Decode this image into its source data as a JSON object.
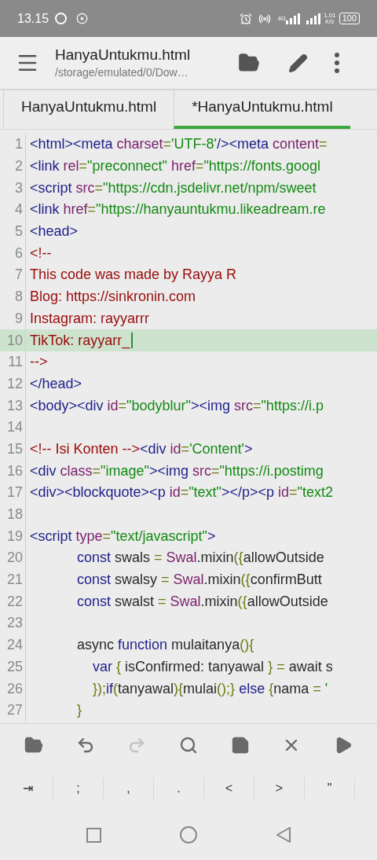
{
  "status_bar": {
    "time": "13.15",
    "network": "4G",
    "speed_value": "1,01",
    "speed_unit": "K/S",
    "battery": "100"
  },
  "header": {
    "title": "HanyaUntukmu.html",
    "path": "/storage/emulated/0/Dow…"
  },
  "tabs": [
    {
      "label": "HanyaUntukmu.html",
      "selected": false
    },
    {
      "label": "*HanyaUntukmu.html",
      "selected": true
    }
  ],
  "editor": {
    "lines": [
      {
        "number": "1",
        "current": false,
        "tokens": [
          {
            "kind": "tag",
            "text": "<html><meta "
          },
          {
            "kind": "attr",
            "text": "charset"
          },
          {
            "kind": "punct",
            "text": "="
          },
          {
            "kind": "str",
            "text": "'UTF-8'"
          },
          {
            "kind": "tag",
            "text": "/><meta "
          },
          {
            "kind": "attr",
            "text": "content"
          },
          {
            "kind": "punct",
            "text": "="
          }
        ]
      },
      {
        "number": "2",
        "current": false,
        "tokens": [
          {
            "kind": "tag",
            "text": "<link "
          },
          {
            "kind": "attr",
            "text": "rel"
          },
          {
            "kind": "punct",
            "text": "="
          },
          {
            "kind": "str",
            "text": "\"preconnect\""
          },
          {
            "kind": "attr",
            "text": " href"
          },
          {
            "kind": "punct",
            "text": "="
          },
          {
            "kind": "str",
            "text": "\"https://fonts.googl"
          }
        ]
      },
      {
        "number": "3",
        "current": false,
        "tokens": [
          {
            "kind": "tag",
            "text": "<script "
          },
          {
            "kind": "attr",
            "text": "src"
          },
          {
            "kind": "punct",
            "text": "="
          },
          {
            "kind": "str",
            "text": "\"https://cdn.jsdelivr.net/npm/sweet"
          }
        ]
      },
      {
        "number": "4",
        "current": false,
        "tokens": [
          {
            "kind": "tag",
            "text": "<link "
          },
          {
            "kind": "attr",
            "text": "href"
          },
          {
            "kind": "punct",
            "text": "="
          },
          {
            "kind": "str",
            "text": "\"https://hanyauntukmu.likeadream.re"
          }
        ]
      },
      {
        "number": "5",
        "current": false,
        "tokens": [
          {
            "kind": "tag",
            "text": "<head>"
          }
        ]
      },
      {
        "number": "6",
        "current": false,
        "tokens": [
          {
            "kind": "comment",
            "text": "<!--"
          }
        ]
      },
      {
        "number": "7",
        "current": false,
        "tokens": [
          {
            "kind": "comment",
            "text": "This code was made by Rayya R"
          }
        ]
      },
      {
        "number": "8",
        "current": false,
        "tokens": [
          {
            "kind": "comment",
            "text": "Blog: https://sinkronin.com"
          }
        ]
      },
      {
        "number": "9",
        "current": false,
        "tokens": [
          {
            "kind": "comment",
            "text": "Instagram: rayyarrr"
          }
        ]
      },
      {
        "number": "10",
        "current": true,
        "tokens": [
          {
            "kind": "comment",
            "text": "TikTok: rayyarr_"
          }
        ]
      },
      {
        "number": "11",
        "current": false,
        "tokens": [
          {
            "kind": "comment",
            "text": "-->"
          }
        ]
      },
      {
        "number": "12",
        "current": false,
        "tokens": [
          {
            "kind": "tag",
            "text": "</head>"
          }
        ]
      },
      {
        "number": "13",
        "current": false,
        "tokens": [
          {
            "kind": "tag",
            "text": "<body><div "
          },
          {
            "kind": "attr",
            "text": "id"
          },
          {
            "kind": "punct",
            "text": "="
          },
          {
            "kind": "str",
            "text": "\"bodyblur\""
          },
          {
            "kind": "tag",
            "text": "><img "
          },
          {
            "kind": "attr",
            "text": "src"
          },
          {
            "kind": "punct",
            "text": "="
          },
          {
            "kind": "str",
            "text": "\"https://i.p"
          }
        ]
      },
      {
        "number": "14",
        "current": false
      },
      {
        "number": "15",
        "current": false,
        "tokens": [
          {
            "kind": "comment",
            "text": "<!-- Isi Konten -->"
          },
          {
            "kind": "tag",
            "text": "<div "
          },
          {
            "kind": "attr",
            "text": "id"
          },
          {
            "kind": "punct",
            "text": "="
          },
          {
            "kind": "str",
            "text": "'Content'"
          },
          {
            "kind": "tag",
            "text": ">"
          }
        ]
      },
      {
        "number": "16",
        "current": false,
        "tokens": [
          {
            "kind": "tag",
            "text": "<div "
          },
          {
            "kind": "attr",
            "text": "class"
          },
          {
            "kind": "punct",
            "text": "="
          },
          {
            "kind": "str",
            "text": "\"image\""
          },
          {
            "kind": "tag",
            "text": "><img "
          },
          {
            "kind": "attr",
            "text": "src"
          },
          {
            "kind": "punct",
            "text": "="
          },
          {
            "kind": "str",
            "text": "\"https://i.postimg"
          }
        ]
      },
      {
        "number": "17",
        "current": false,
        "tokens": [
          {
            "kind": "tag",
            "text": "<div><blockquote><p "
          },
          {
            "kind": "attr",
            "text": "id"
          },
          {
            "kind": "punct",
            "text": "="
          },
          {
            "kind": "str",
            "text": "\"text\""
          },
          {
            "kind": "tag",
            "text": "></p><p "
          },
          {
            "kind": "attr",
            "text": "id"
          },
          {
            "kind": "punct",
            "text": "="
          },
          {
            "kind": "str",
            "text": "\"text2"
          }
        ]
      },
      {
        "number": "18",
        "current": false
      },
      {
        "number": "19",
        "current": false,
        "tokens": [
          {
            "kind": "tag",
            "text": "<script "
          },
          {
            "kind": "attr",
            "text": "type"
          },
          {
            "kind": "punct",
            "text": "="
          },
          {
            "kind": "str",
            "text": "\"text/javascript\""
          },
          {
            "kind": "tag",
            "text": ">"
          }
        ]
      },
      {
        "number": "20",
        "current": false,
        "tokens": [
          {
            "kind": "keyword",
            "text": "            const"
          },
          {
            "kind": "plain",
            "text": " swals "
          },
          {
            "kind": "punct",
            "text": "="
          },
          {
            "kind": "attr",
            "text": " Swal"
          },
          {
            "kind": "plain",
            "text": ".mixin"
          },
          {
            "kind": "punct",
            "text": "({"
          },
          {
            "kind": "plain",
            "text": "allowOutside"
          }
        ]
      },
      {
        "number": "21",
        "current": false,
        "tokens": [
          {
            "kind": "keyword",
            "text": "            const"
          },
          {
            "kind": "plain",
            "text": " swalsy "
          },
          {
            "kind": "punct",
            "text": "="
          },
          {
            "kind": "attr",
            "text": " Swal"
          },
          {
            "kind": "plain",
            "text": ".mixin"
          },
          {
            "kind": "punct",
            "text": "({"
          },
          {
            "kind": "plain",
            "text": "confirmButt"
          }
        ]
      },
      {
        "number": "22",
        "current": false,
        "tokens": [
          {
            "kind": "keyword",
            "text": "            const"
          },
          {
            "kind": "plain",
            "text": " swalst "
          },
          {
            "kind": "punct",
            "text": "="
          },
          {
            "kind": "attr",
            "text": " Swal"
          },
          {
            "kind": "plain",
            "text": ".mixin"
          },
          {
            "kind": "punct",
            "text": "({"
          },
          {
            "kind": "plain",
            "text": "allowOutside"
          }
        ]
      },
      {
        "number": "23",
        "current": false
      },
      {
        "number": "24",
        "current": false,
        "tokens": [
          {
            "kind": "plain",
            "text": "            async "
          },
          {
            "kind": "keyword",
            "text": "function"
          },
          {
            "kind": "plain",
            "text": " mulaitanya"
          },
          {
            "kind": "punct",
            "text": "(){"
          }
        ]
      },
      {
        "number": "25",
        "current": false,
        "tokens": [
          {
            "kind": "keyword",
            "text": "                var"
          },
          {
            "kind": "punct",
            "text": " {"
          },
          {
            "kind": "plain",
            "text": " isConfirmed: tanyawal "
          },
          {
            "kind": "punct",
            "text": "} ="
          },
          {
            "kind": "plain",
            "text": " await s"
          }
        ]
      },
      {
        "number": "26",
        "current": false,
        "tokens": [
          {
            "kind": "punct",
            "text": "                });"
          },
          {
            "kind": "keyword",
            "text": "if"
          },
          {
            "kind": "punct",
            "text": "("
          },
          {
            "kind": "plain",
            "text": "tanyawal"
          },
          {
            "kind": "punct",
            "text": "){"
          },
          {
            "kind": "plain",
            "text": "mulai"
          },
          {
            "kind": "punct",
            "text": "();}"
          },
          {
            "kind": "keyword",
            "text": " else "
          },
          {
            "kind": "punct",
            "text": "{"
          },
          {
            "kind": "plain",
            "text": "nama "
          },
          {
            "kind": "punct",
            "text": "="
          },
          {
            "kind": "str",
            "text": " '"
          }
        ]
      },
      {
        "number": "27",
        "current": false,
        "tokens": [
          {
            "kind": "punct",
            "text": "            }"
          }
        ]
      }
    ]
  },
  "toolbar": [
    {
      "kind": "open",
      "disabled": false
    },
    {
      "kind": "undo",
      "disabled": false
    },
    {
      "kind": "redo",
      "disabled": true
    },
    {
      "kind": "search",
      "disabled": false
    },
    {
      "kind": "save",
      "disabled": false
    },
    {
      "kind": "close",
      "disabled": false
    },
    {
      "kind": "run",
      "disabled": false
    }
  ],
  "symbol_keys": [
    "⇥",
    ";",
    ",",
    ".",
    "<",
    ">",
    "\""
  ]
}
